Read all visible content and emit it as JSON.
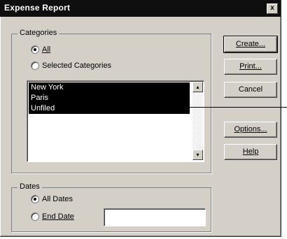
{
  "window": {
    "title": "Expense Report",
    "close_glyph": "x"
  },
  "categories": {
    "group_label": "Categories",
    "all_label": "All",
    "selected_label": "Selected Categories",
    "selected_option": "All",
    "items": [
      "New York",
      "Paris",
      "Unfiled"
    ]
  },
  "buttons": {
    "create": "Create...",
    "print": "Print...",
    "cancel": "Cancel",
    "options": "Options...",
    "help": "Help"
  },
  "dates": {
    "group_label": "Dates",
    "all_label": "All Dates",
    "end_label": "End Date",
    "selected_option": "All Dates",
    "end_date_value": ""
  },
  "icons": {
    "close": "close-icon",
    "scroll_up": "scroll-up-arrow-icon",
    "scroll_down": "scroll-down-arrow-icon"
  }
}
